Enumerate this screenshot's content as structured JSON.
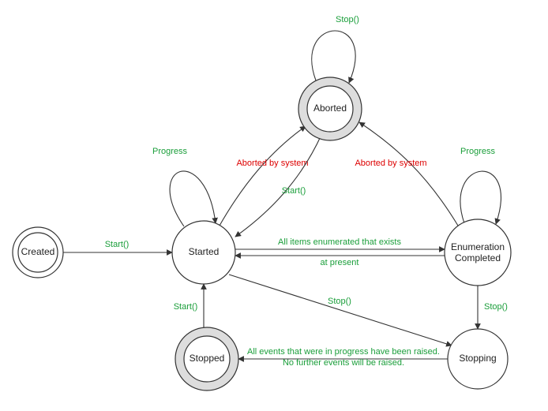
{
  "chart_data": {
    "type": "state-diagram",
    "title": "",
    "states": [
      {
        "id": "created",
        "label": "Created",
        "kind": "initial"
      },
      {
        "id": "started",
        "label": "Started",
        "kind": "normal"
      },
      {
        "id": "aborted",
        "label": "Aborted",
        "kind": "final"
      },
      {
        "id": "enumdone",
        "label": "Enumeration Completed",
        "kind": "normal"
      },
      {
        "id": "stopping",
        "label": "Stopping",
        "kind": "normal"
      },
      {
        "id": "stopped",
        "label": "Stopped",
        "kind": "final"
      }
    ],
    "transitions": [
      {
        "from": "created",
        "to": "started",
        "label": "Start()",
        "color": "green"
      },
      {
        "from": "started",
        "to": "started",
        "label": "Progress",
        "color": "green",
        "self": true
      },
      {
        "from": "started",
        "to": "aborted",
        "label": "Aborted by system",
        "color": "red"
      },
      {
        "from": "aborted",
        "to": "started",
        "label": "Start()",
        "color": "green"
      },
      {
        "from": "aborted",
        "to": "aborted",
        "label": "Stop()",
        "color": "green",
        "self": true
      },
      {
        "from": "started",
        "to": "enumdone",
        "label": "All items enumerated that exists at present",
        "color": "green"
      },
      {
        "from": "enumdone",
        "to": "started",
        "label": "",
        "color": "green"
      },
      {
        "from": "enumdone",
        "to": "enumdone",
        "label": "Progress",
        "color": "green",
        "self": true
      },
      {
        "from": "enumdone",
        "to": "aborted",
        "label": "Aborted by system",
        "color": "red"
      },
      {
        "from": "enumdone",
        "to": "stopping",
        "label": "Stop()",
        "color": "green"
      },
      {
        "from": "started",
        "to": "stopping",
        "label": "Stop()",
        "color": "green"
      },
      {
        "from": "stopping",
        "to": "stopped",
        "label": "All events that were in progress have been raised. No further events will be raised.",
        "color": "green"
      },
      {
        "from": "stopped",
        "to": "started",
        "label": "Start()",
        "color": "green"
      }
    ]
  },
  "labels": {
    "created": "Created",
    "started": "Started",
    "aborted": "Aborted",
    "enum1": "Enumeration",
    "enum2": "Completed",
    "stopping": "Stopping",
    "stopped": "Stopped",
    "t_start": "Start()",
    "t_progress": "Progress",
    "t_stop": "Stop()",
    "t_abort": "Aborted by system",
    "t_enum1": "All items enumerated that exists",
    "t_enum2": "at present",
    "t_done1": "All events that were in progress have been raised.",
    "t_done2": "No further events will be raised."
  }
}
